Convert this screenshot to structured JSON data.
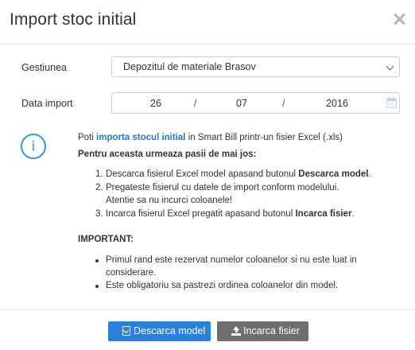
{
  "dialog": {
    "title": "Import stoc initial"
  },
  "form": {
    "gestiune_label": "Gestiunea",
    "gestiune_value": "Depozitul de materiale Brasov",
    "date_label": "Data import",
    "date": {
      "day": "26",
      "month": "07",
      "year": "2016",
      "separator": "/"
    }
  },
  "info": {
    "intro_prefix": "Poti",
    "intro_link": "importa stocul initial",
    "intro_suffix": "in Smart Bill printr-un fisier Excel (.xls)",
    "steps_heading": "Pentru aceasta urmeaza pasii de mai jos:",
    "steps": [
      {
        "num": "1.",
        "text": "Descarca fisierul Excel model apasand butonul",
        "bold": "Descarca model",
        "end": "."
      },
      {
        "num": "2.",
        "line1": "Pregateste fisierul cu datele de import conform modelului.",
        "line2": "Atentie sa nu incurci coloanele!"
      },
      {
        "num": "3.",
        "text": "Incarca fisierul Excel pregatit apasand butonul",
        "bold": "Incarca fisier",
        "end": "."
      }
    ],
    "important_label": "IMPORTANT:",
    "important_items": [
      {
        "line1": "Primul rand este rezervat numelor coloanelor si nu este luat in",
        "line2": "considerare."
      },
      {
        "line1": "Este obligatoriu sa pastrezi ordinea coloanelor din model."
      }
    ]
  },
  "buttons": {
    "download_label": "Descarca model",
    "upload_label": "Incarca fisier"
  },
  "icons": {
    "close": "close-icon",
    "dropdown": "chevron-down-icon",
    "calendar": "calendar-icon",
    "info": "info-icon",
    "download": "file-download-icon",
    "upload": "upload-icon"
  },
  "colors": {
    "accent": "#2e7fd6",
    "link": "#2a77c4",
    "info_icon": "#3a95d6",
    "secondary_button": "#6e6e6e"
  }
}
